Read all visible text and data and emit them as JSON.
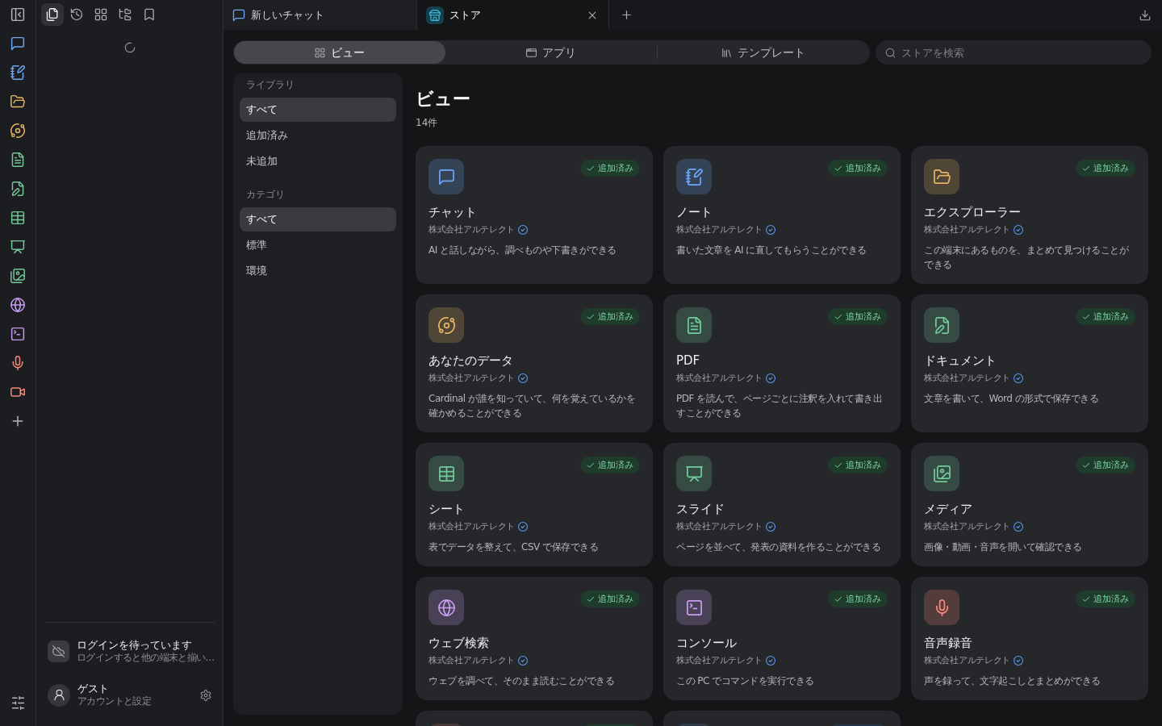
{
  "sidebar": {
    "tools": [
      {
        "selected": true
      },
      {
        "selected": false
      },
      {
        "selected": false
      },
      {
        "selected": false
      },
      {
        "selected": false
      }
    ],
    "login": {
      "title": "ログインを待っています",
      "subtitle": "ログインすると他の端末と揃い…"
    },
    "account": {
      "name": "ゲスト",
      "subtitle": "アカウントと設定"
    }
  },
  "tabs": [
    {
      "label": "新しいチャット",
      "selected": false
    },
    {
      "label": "ストア",
      "selected": true
    }
  ],
  "store": {
    "segments": [
      {
        "label": "ビュー",
        "selected": true
      },
      {
        "label": "アプリ",
        "selected": false
      },
      {
        "label": "テンプレート",
        "selected": false
      }
    ],
    "search": {
      "placeholder": "ストアを検索"
    },
    "filters": [
      {
        "heading": "ライブラリ",
        "items": [
          {
            "label": "すべて",
            "selected": true
          },
          {
            "label": "追加済み",
            "selected": false
          },
          {
            "label": "未追加",
            "selected": false
          }
        ]
      },
      {
        "heading": "カテゴリ",
        "items": [
          {
            "label": "すべて",
            "selected": true
          },
          {
            "label": "標準",
            "selected": false
          },
          {
            "label": "環境",
            "selected": false
          }
        ]
      }
    ],
    "title": "ビュー",
    "count": "14件",
    "cards": [
      {
        "title": "チャット",
        "publisher": "株式会社アルテレクト",
        "description": "AI と話しながら、調べものや下書きができる",
        "badge": "追加済み",
        "added": true,
        "color": "#354357"
      },
      {
        "title": "ノート",
        "publisher": "株式会社アルテレクト",
        "description": "書いた文章を AI に直してもらうことができる",
        "badge": "追加済み",
        "added": true,
        "color": "#354357"
      },
      {
        "title": "エクスプローラー",
        "publisher": "株式会社アルテレクト",
        "description": "この端末にあるものを、まとめて見つけることができる",
        "badge": "追加済み",
        "added": true,
        "color": "#4f4637"
      },
      {
        "title": "あなたのデータ",
        "publisher": "株式会社アルテレクト",
        "description": "Cardinal が誰を知っていて、何を覚えているかを確かめることができる",
        "badge": "追加済み",
        "added": true,
        "color": "#4f4637"
      },
      {
        "title": "PDF",
        "publisher": "株式会社アルテレクト",
        "description": "PDF を読んで、ページごとに注釈を入れて書き出すことができる",
        "badge": "追加済み",
        "added": true,
        "color": "#364b43"
      },
      {
        "title": "ドキュメント",
        "publisher": "株式会社アルテレクト",
        "description": "文章を書いて、Word の形式で保存できる",
        "badge": "追加済み",
        "added": true,
        "color": "#364b43"
      },
      {
        "title": "シート",
        "publisher": "株式会社アルテレクト",
        "description": "表でデータを整えて、CSV で保存できる",
        "badge": "追加済み",
        "added": true,
        "color": "#364b43"
      },
      {
        "title": "スライド",
        "publisher": "株式会社アルテレクト",
        "description": "ページを並べて、発表の資料を作ることができる",
        "badge": "追加済み",
        "added": true,
        "color": "#364b43"
      },
      {
        "title": "メディア",
        "publisher": "株式会社アルテレクト",
        "description": "画像・動画・音声を開いて確認できる",
        "badge": "追加済み",
        "added": true,
        "color": "#364b43"
      },
      {
        "title": "ウェブ検索",
        "publisher": "株式会社アルテレクト",
        "description": "ウェブを調べて、そのまま読むことができる",
        "badge": "追加済み",
        "added": true,
        "color": "#494156"
      },
      {
        "title": "コンソール",
        "publisher": "株式会社アルテレクト",
        "description": "この PC でコマンドを実行できる",
        "badge": "追加済み",
        "added": true,
        "color": "#494156"
      },
      {
        "title": "音声録音",
        "publisher": "株式会社アルテレクト",
        "description": "声を録って、文字起こしとまとめができる",
        "badge": "追加済み",
        "added": true,
        "color": "#533d3c"
      }
    ],
    "cards_cut_off": [
      {
        "color": "#4a3538",
        "added": true
      },
      {
        "color": "#2f3c4e",
        "added": false
      }
    ]
  }
}
